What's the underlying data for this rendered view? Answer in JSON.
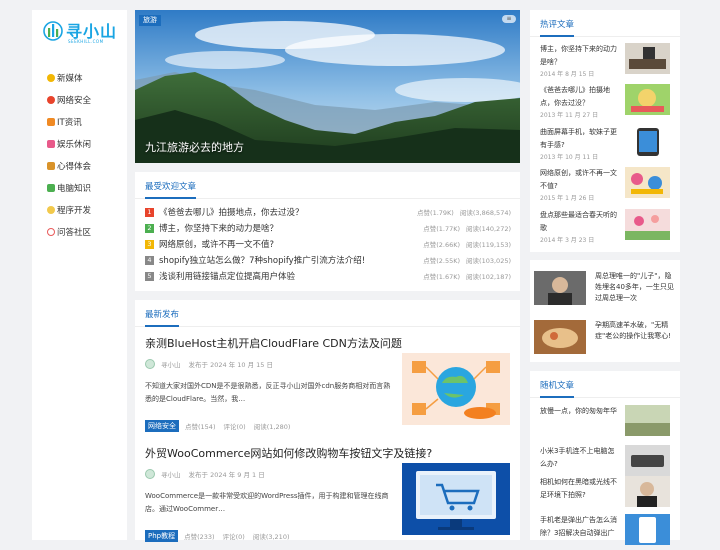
{
  "site": {
    "logo_text": "寻小山",
    "logo_sub": "SEEKHILL.COM"
  },
  "nav": [
    {
      "label": "新媒体",
      "color": "#f2b705"
    },
    {
      "label": "网络安全",
      "color": "#e8442c"
    },
    {
      "label": "IT资讯",
      "color": "#f08a24"
    },
    {
      "label": "娱乐休闲",
      "color": "#e85a8a"
    },
    {
      "label": "心得体会",
      "color": "#d9932a"
    },
    {
      "label": "电脑知识",
      "color": "#4caf50"
    },
    {
      "label": "程序开发",
      "color": "#f2c94c"
    },
    {
      "label": "问答社区",
      "color": "#e85a5a"
    }
  ],
  "hero": {
    "tag": "旅游",
    "dots": "≡",
    "title": "九江旅游必去的地方"
  },
  "popular": {
    "heading": "最受欢迎文章",
    "items": [
      {
        "num": "1",
        "color": "#e8442c",
        "title": "《爸爸去哪儿》拍摄地点，你去过没？",
        "likes": "点赞(1.79K)",
        "reads": "阅读(3,868,574)"
      },
      {
        "num": "2",
        "color": "#4caf50",
        "title": "博主，你坚持下来的动力是啥？",
        "likes": "点赞(1.77K)",
        "reads": "阅读(140,272)"
      },
      {
        "num": "3",
        "color": "#f2b705",
        "title": "网络原创，或许不再一文不值?",
        "likes": "点赞(2.66K)",
        "reads": "阅读(119,153)"
      },
      {
        "num": "4",
        "color": "#888888",
        "title": "shopify独立站怎么做？7种shopify推广引流方法介绍!",
        "likes": "点赞(2.55K)",
        "reads": "阅读(103,025)"
      },
      {
        "num": "5",
        "color": "#888888",
        "title": "浅谈利用链接锚点定位提高用户体验",
        "likes": "点赞(1.67K)",
        "reads": "阅读(102,187)"
      }
    ]
  },
  "latest": {
    "heading": "最新发布",
    "articles": [
      {
        "title": "亲测BlueHost主机开启CloudFlare CDN方法及问题",
        "author": "寻小山",
        "date": "发布于 2024 年 10 月 15 日",
        "excerpt": "不知道大家对国外CDN是不是很熟悉，反正寻小山对国外cdn服务商相对而言熟悉的是CloudFlare。当然，我…",
        "tag": "网络安全",
        "likes": "点赞(154)",
        "comments": "评论(0)",
        "reads": "阅读(1,280)"
      },
      {
        "title": "外贸WooCommerce网站如何修改购物车按钮文字及链接?",
        "author": "寻小山",
        "date": "发布于 2024 年 9 月 1 日",
        "excerpt": "WooCommerce是一款非常受欢迎的WordPress插件，用于构建和管理在线商店。通过WooCommer…",
        "tag": "Php教程",
        "likes": "点赞(233)",
        "comments": "评论(0)",
        "reads": "阅读(3,210)"
      }
    ]
  },
  "hot": {
    "heading": "热评文章",
    "items": [
      {
        "title": "博主，你坚持下来的动力是啥？",
        "date": "2014 年 8 月 15 日"
      },
      {
        "title": "《爸爸去哪儿》拍摄地点，你去过没？",
        "date": "2013 年 11 月 27 日"
      },
      {
        "title": "曲面屏幕手机，软妹子更有手感?",
        "date": "2013 年 10 月 11 日"
      },
      {
        "title": "网络原创，或许不再一文不值?",
        "date": "2015 年 1 月 26 日"
      },
      {
        "title": "盘点那些最适合春天听的歌",
        "date": "2014 年 3 月 23 日"
      }
    ]
  },
  "mid": {
    "items": [
      {
        "title": "周总理唯一的\"儿子\"，隐姓埋名40多年，一生只见过周总理一次"
      },
      {
        "title": "孕期高速羊水破，\"无精症\"老公的操作让我寒心!"
      }
    ]
  },
  "random": {
    "heading": "随机文章",
    "items": [
      {
        "title": "放慢一点，你的匆匆年华"
      },
      {
        "title": "小米3手机连不上电脑怎么办?"
      },
      {
        "title": "相机如何在黑暗或光线不足环境下拍照?"
      },
      {
        "title": "手机老是弹出广告怎么消除？3招解决自动弹出广"
      }
    ]
  }
}
